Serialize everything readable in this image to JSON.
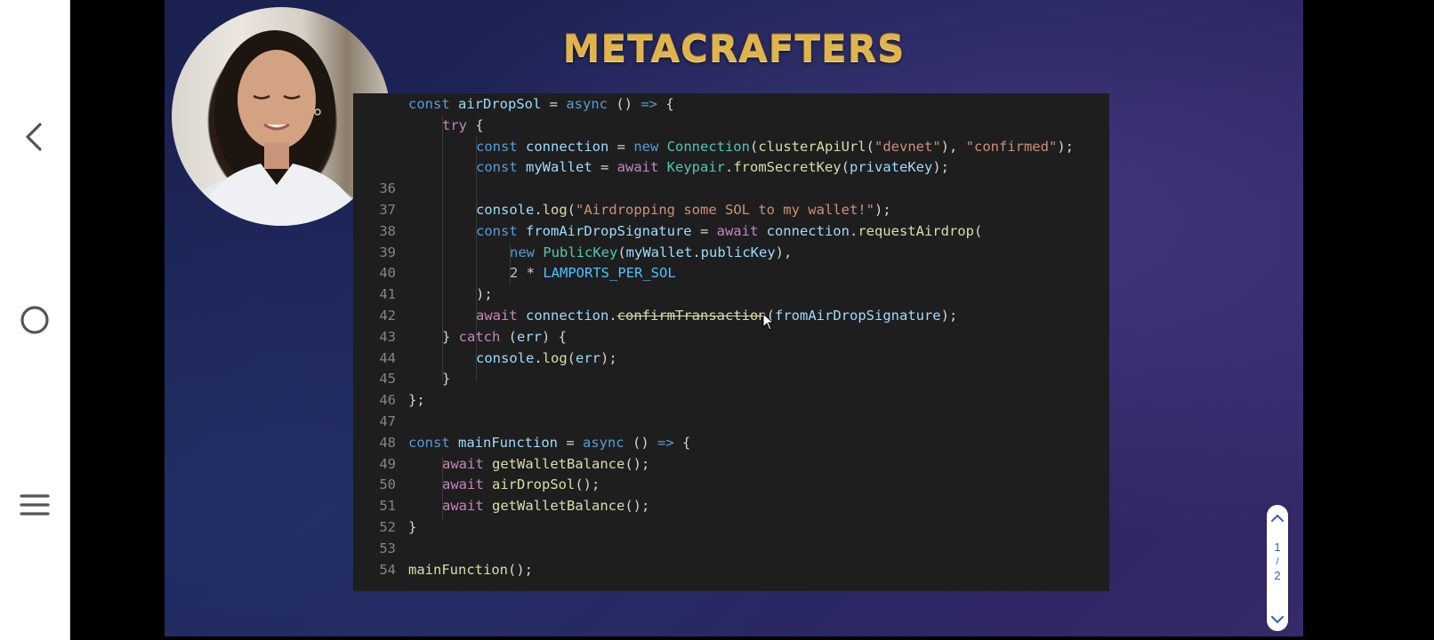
{
  "nav": {
    "back_icon": "chevron-left-icon",
    "home_icon": "circle-home-icon",
    "menu_icon": "hamburger-menu-icon"
  },
  "video": {
    "logo": "METACRAFTERS",
    "code_lines": [
      {
        "ln": "",
        "indent": 0,
        "tokens": [
          [
            "k",
            "const "
          ],
          [
            "v",
            "airDropSol"
          ],
          [
            "p",
            " = "
          ],
          [
            "k",
            "async "
          ],
          [
            "p",
            "() "
          ],
          [
            "k",
            "=>"
          ],
          [
            "p",
            " {"
          ]
        ]
      },
      {
        "ln": "",
        "indent": 1,
        "tokens": [
          [
            "c",
            "try"
          ],
          [
            "p",
            " {"
          ]
        ]
      },
      {
        "ln": "",
        "indent": 2,
        "tokens": [
          [
            "k",
            "const "
          ],
          [
            "v",
            "connection"
          ],
          [
            "p",
            " = "
          ],
          [
            "k",
            "new "
          ],
          [
            "t",
            "Connection"
          ],
          [
            "p",
            "("
          ],
          [
            "f",
            "clusterApiUrl"
          ],
          [
            "p",
            "("
          ],
          [
            "s",
            "\"devnet\""
          ],
          [
            "p",
            "), "
          ],
          [
            "s",
            "\"confirmed\""
          ],
          [
            "p",
            ");"
          ]
        ]
      },
      {
        "ln": "",
        "indent": 2,
        "tokens": [
          [
            "k",
            "const "
          ],
          [
            "v",
            "myWallet"
          ],
          [
            "p",
            " = "
          ],
          [
            "c",
            "await "
          ],
          [
            "t",
            "Keypair"
          ],
          [
            "p",
            "."
          ],
          [
            "f",
            "fromSecretKey"
          ],
          [
            "p",
            "("
          ],
          [
            "v",
            "privateKey"
          ],
          [
            "p",
            ");"
          ]
        ]
      },
      {
        "ln": "36",
        "indent": 0,
        "tokens": []
      },
      {
        "ln": "37",
        "indent": 2,
        "tokens": [
          [
            "v",
            "console"
          ],
          [
            "p",
            "."
          ],
          [
            "f",
            "log"
          ],
          [
            "p",
            "("
          ],
          [
            "s",
            "\"Airdropping some SOL to my wallet!\""
          ],
          [
            "p",
            ");"
          ]
        ]
      },
      {
        "ln": "38",
        "indent": 2,
        "tokens": [
          [
            "k",
            "const "
          ],
          [
            "v",
            "fromAirDropSignature"
          ],
          [
            "p",
            " = "
          ],
          [
            "c",
            "await "
          ],
          [
            "v",
            "connection"
          ],
          [
            "p",
            "."
          ],
          [
            "f",
            "requestAirdrop"
          ],
          [
            "p",
            "("
          ]
        ]
      },
      {
        "ln": "39",
        "indent": 3,
        "tokens": [
          [
            "k",
            "new "
          ],
          [
            "t",
            "PublicKey"
          ],
          [
            "p",
            "("
          ],
          [
            "v",
            "myWallet"
          ],
          [
            "p",
            "."
          ],
          [
            "v",
            "publicKey"
          ],
          [
            "p",
            "),"
          ]
        ]
      },
      {
        "ln": "40",
        "indent": 3,
        "tokens": [
          [
            "n",
            "2"
          ],
          [
            "p",
            " * "
          ],
          [
            "const",
            "LAMPORTS_PER_SOL"
          ]
        ]
      },
      {
        "ln": "41",
        "indent": 2,
        "tokens": [
          [
            "p",
            ");"
          ]
        ]
      },
      {
        "ln": "42",
        "indent": 2,
        "tokens": [
          [
            "c",
            "await "
          ],
          [
            "v",
            "connection"
          ],
          [
            "p",
            "."
          ],
          [
            "strike",
            "confirmTransaction"
          ],
          [
            "p",
            "("
          ],
          [
            "v",
            "fromAirDropSignature"
          ],
          [
            "p",
            ");"
          ]
        ]
      },
      {
        "ln": "43",
        "indent": 1,
        "tokens": [
          [
            "p",
            "} "
          ],
          [
            "c",
            "catch"
          ],
          [
            "p",
            " ("
          ],
          [
            "v",
            "err"
          ],
          [
            "p",
            ") {"
          ]
        ]
      },
      {
        "ln": "44",
        "indent": 2,
        "tokens": [
          [
            "v",
            "console"
          ],
          [
            "p",
            "."
          ],
          [
            "f",
            "log"
          ],
          [
            "p",
            "("
          ],
          [
            "v",
            "err"
          ],
          [
            "p",
            ");"
          ]
        ]
      },
      {
        "ln": "45",
        "indent": 1,
        "tokens": [
          [
            "p",
            "}"
          ]
        ]
      },
      {
        "ln": "46",
        "indent": 0,
        "tokens": [
          [
            "p",
            "};"
          ]
        ]
      },
      {
        "ln": "47",
        "indent": 0,
        "tokens": []
      },
      {
        "ln": "48",
        "indent": 0,
        "tokens": [
          [
            "k",
            "const "
          ],
          [
            "v",
            "mainFunction"
          ],
          [
            "p",
            " = "
          ],
          [
            "k",
            "async "
          ],
          [
            "p",
            "() "
          ],
          [
            "k",
            "=>"
          ],
          [
            "p",
            " {"
          ]
        ]
      },
      {
        "ln": "49",
        "indent": 1,
        "tokens": [
          [
            "c",
            "await "
          ],
          [
            "f",
            "getWalletBalance"
          ],
          [
            "p",
            "();"
          ]
        ]
      },
      {
        "ln": "50",
        "indent": 1,
        "tokens": [
          [
            "c",
            "await "
          ],
          [
            "f",
            "airDropSol"
          ],
          [
            "p",
            "();"
          ]
        ]
      },
      {
        "ln": "51",
        "indent": 1,
        "tokens": [
          [
            "c",
            "await "
          ],
          [
            "f",
            "getWalletBalance"
          ],
          [
            "p",
            "();"
          ]
        ]
      },
      {
        "ln": "52",
        "indent": 0,
        "tokens": [
          [
            "p",
            "}"
          ]
        ]
      },
      {
        "ln": "53",
        "indent": 0,
        "tokens": []
      },
      {
        "ln": "54",
        "indent": 0,
        "tokens": [
          [
            "f",
            "mainFunction"
          ],
          [
            "p",
            "();"
          ]
        ]
      }
    ]
  },
  "scroller": {
    "up_icon": "chevron-up-icon",
    "current_page": "1",
    "separator": "/",
    "total_pages": "2",
    "down_icon": "chevron-down-icon"
  }
}
